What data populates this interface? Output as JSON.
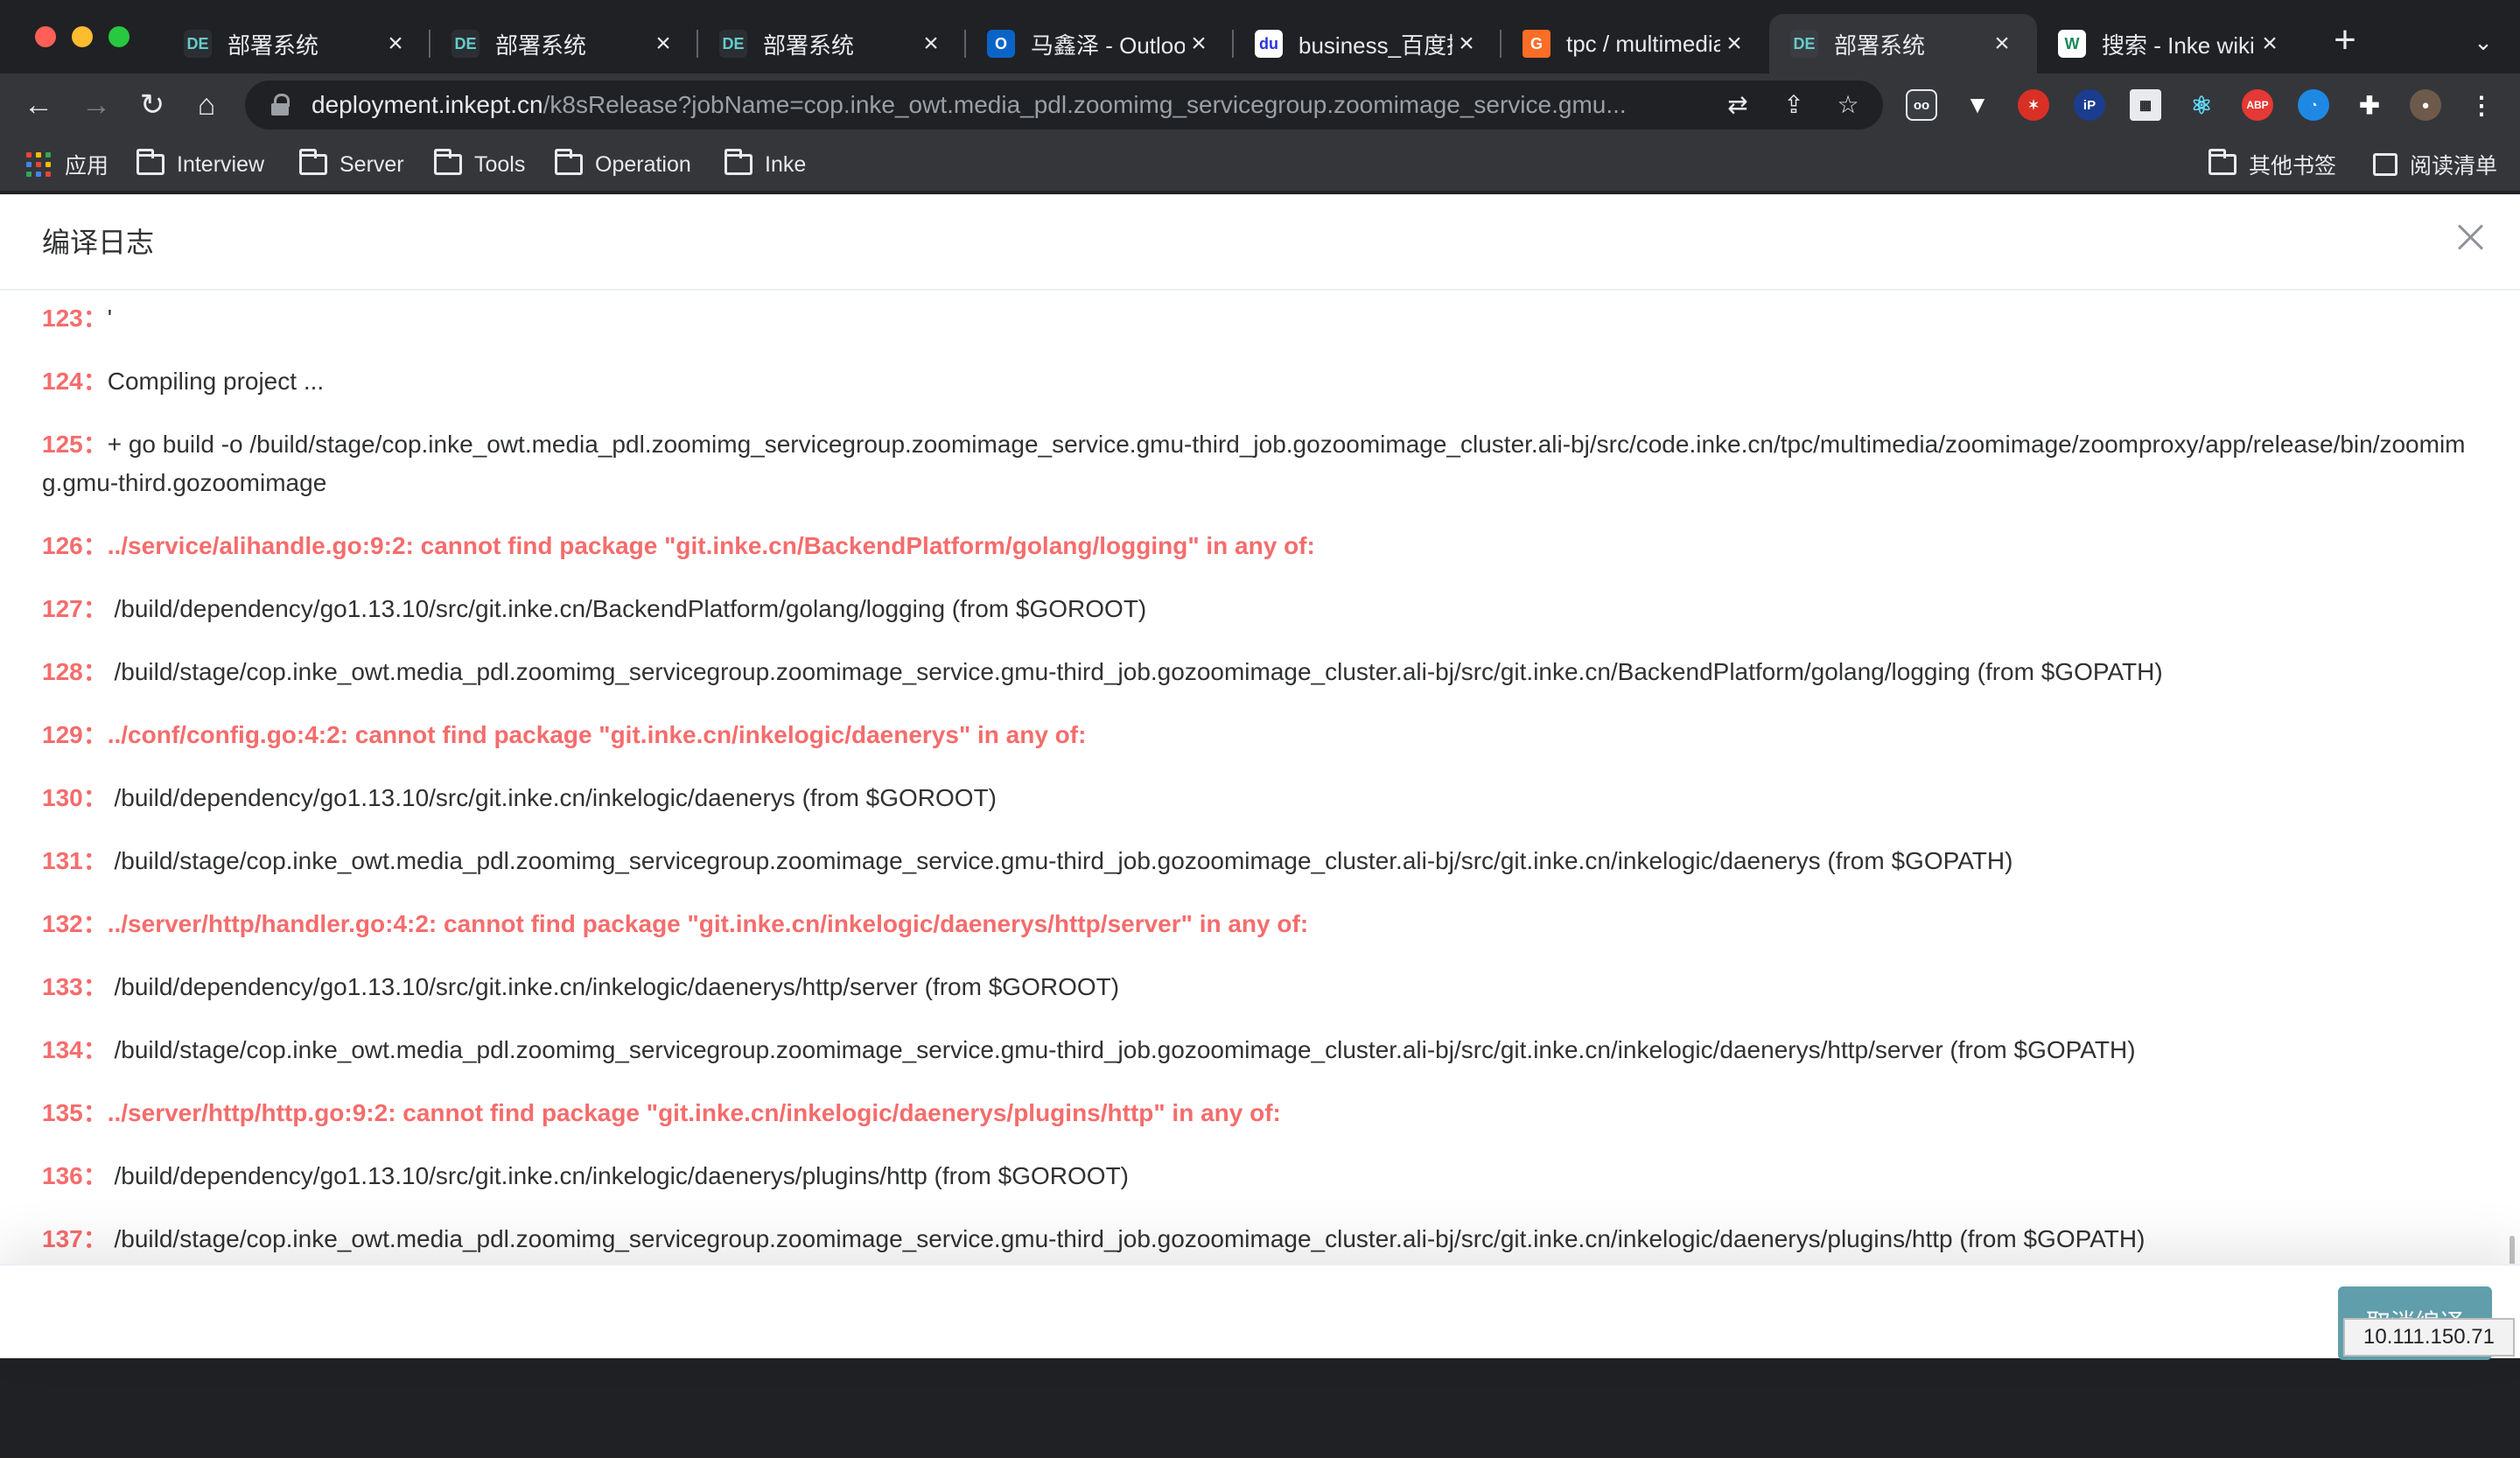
{
  "browser": {
    "tabs": [
      {
        "title": "部署系统",
        "icon": "deploy-logo-icon",
        "active": false
      },
      {
        "title": "部署系统",
        "icon": "deploy-logo-icon",
        "active": false
      },
      {
        "title": "部署系统",
        "icon": "deploy-logo-icon",
        "active": false
      },
      {
        "title": "马鑫泽 - Outlook",
        "icon": "outlook-icon",
        "active": false
      },
      {
        "title": "business_百度搜",
        "icon": "baidu-icon",
        "active": false
      },
      {
        "title": "tpc / multimedia",
        "icon": "gitlab-icon",
        "active": false
      },
      {
        "title": "部署系统",
        "icon": "deploy-logo-icon",
        "active": true
      },
      {
        "title": "搜索 - Inke wiki",
        "icon": "wiki-icon",
        "active": false
      }
    ],
    "address": {
      "host": "deployment.inkept.cn",
      "path": "/k8sRelease?jobName=cop.inke_owt.media_pdl.zoomimg_servicegroup.zoomimage_service.gmu..."
    },
    "bookmarks": {
      "apps": "应用",
      "folders": [
        "Interview",
        "Server",
        "Tools",
        "Operation",
        "Inke"
      ],
      "other": "其他书签",
      "reading_list": "阅读清单"
    },
    "colors": {
      "tab_active": "#35363a",
      "chrome_bg": "#202124"
    }
  },
  "modal": {
    "title": "编译日志",
    "cancel_button": "取消编译",
    "ip_tooltip": "10.111.150.71"
  },
  "log_lines": [
    {
      "num": "123：",
      "text": "'",
      "error": false
    },
    {
      "num": "124：",
      "text": "Compiling project ...",
      "error": false
    },
    {
      "num": "125：",
      "text": "+ go build -o /build/stage/cop.inke_owt.media_pdl.zoomimg_servicegroup.zoomimage_service.gmu-third_job.gozoomimage_cluster.ali-bj/src/code.inke.cn/tpc/multimedia/zoomimage/zoomproxy/app/release/bin/zoomimg.gmu-third.gozoomimage",
      "error": false
    },
    {
      "num": "126：",
      "text": "../service/alihandle.go:9:2: cannot find package \"git.inke.cn/BackendPlatform/golang/logging\" in any of:",
      "error": true
    },
    {
      "num": "127：",
      "text": " /build/dependency/go1.13.10/src/git.inke.cn/BackendPlatform/golang/logging (from $GOROOT)",
      "error": false
    },
    {
      "num": "128：",
      "text": " /build/stage/cop.inke_owt.media_pdl.zoomimg_servicegroup.zoomimage_service.gmu-third_job.gozoomimage_cluster.ali-bj/src/git.inke.cn/BackendPlatform/golang/logging (from $GOPATH)",
      "error": false
    },
    {
      "num": "129：",
      "text": "../conf/config.go:4:2: cannot find package \"git.inke.cn/inkelogic/daenerys\" in any of:",
      "error": true
    },
    {
      "num": "130：",
      "text": " /build/dependency/go1.13.10/src/git.inke.cn/inkelogic/daenerys (from $GOROOT)",
      "error": false
    },
    {
      "num": "131：",
      "text": " /build/stage/cop.inke_owt.media_pdl.zoomimg_servicegroup.zoomimage_service.gmu-third_job.gozoomimage_cluster.ali-bj/src/git.inke.cn/inkelogic/daenerys (from $GOPATH)",
      "error": false
    },
    {
      "num": "132：",
      "text": "../server/http/handler.go:4:2: cannot find package \"git.inke.cn/inkelogic/daenerys/http/server\" in any of:",
      "error": true
    },
    {
      "num": "133：",
      "text": " /build/dependency/go1.13.10/src/git.inke.cn/inkelogic/daenerys/http/server (from $GOROOT)",
      "error": false
    },
    {
      "num": "134：",
      "text": " /build/stage/cop.inke_owt.media_pdl.zoomimg_servicegroup.zoomimage_service.gmu-third_job.gozoomimage_cluster.ali-bj/src/git.inke.cn/inkelogic/daenerys/http/server (from $GOPATH)",
      "error": false
    },
    {
      "num": "135：",
      "text": "../server/http/http.go:9:2: cannot find package \"git.inke.cn/inkelogic/daenerys/plugins/http\" in any of:",
      "error": true
    },
    {
      "num": "136：",
      "text": " /build/dependency/go1.13.10/src/git.inke.cn/inkelogic/daenerys/plugins/http (from $GOROOT)",
      "error": false
    },
    {
      "num": "137：",
      "text": " /build/stage/cop.inke_owt.media_pdl.zoomimg_servicegroup.zoomimage_service.gmu-third_job.gozoomimage_cluster.ali-bj/src/git.inke.cn/inkelogic/daenerys/plugins/http (from $GOPATH)",
      "error": false
    }
  ]
}
